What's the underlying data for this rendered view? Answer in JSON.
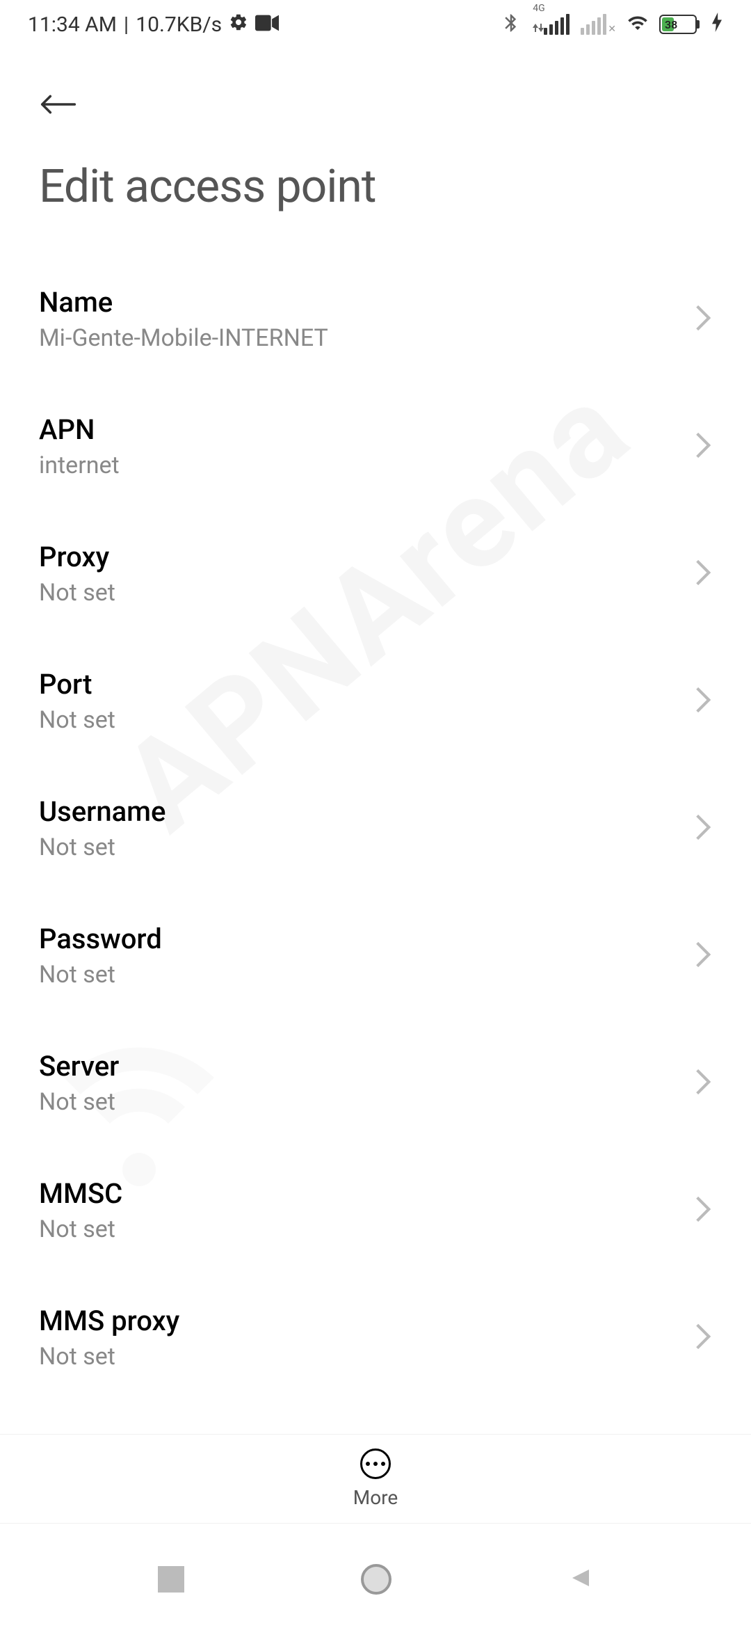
{
  "status": {
    "time": "11:34 AM",
    "speed": "10.7KB/s",
    "signal_label": "4G",
    "battery_pct": "38"
  },
  "header": {
    "title": "Edit access point"
  },
  "items": [
    {
      "label": "Name",
      "value": "Mi-Gente-Mobile-INTERNET"
    },
    {
      "label": "APN",
      "value": "internet"
    },
    {
      "label": "Proxy",
      "value": "Not set"
    },
    {
      "label": "Port",
      "value": "Not set"
    },
    {
      "label": "Username",
      "value": "Not set"
    },
    {
      "label": "Password",
      "value": "Not set"
    },
    {
      "label": "Server",
      "value": "Not set"
    },
    {
      "label": "MMSC",
      "value": "Not set"
    },
    {
      "label": "MMS proxy",
      "value": "Not set"
    }
  ],
  "bottom": {
    "more": "More"
  },
  "watermark": "APNArena"
}
